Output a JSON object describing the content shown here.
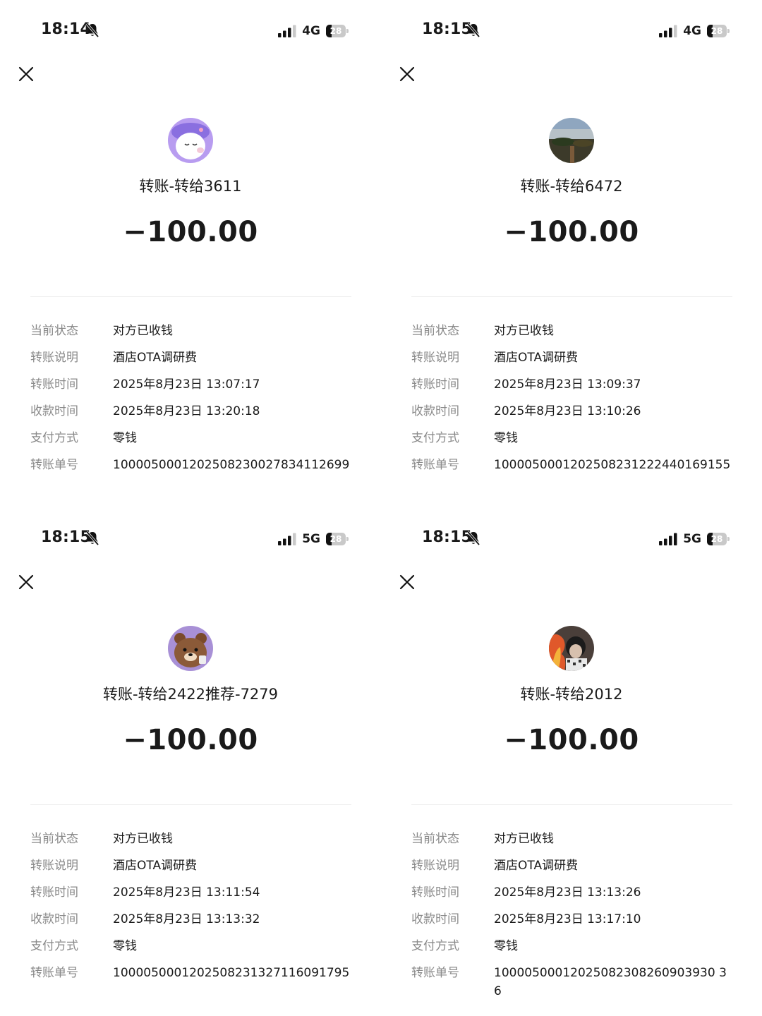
{
  "labels": {
    "status": "当前状态",
    "remark": "转账说明",
    "transfer_time": "转账时间",
    "receive_time": "收款时间",
    "pay_method": "支付方式",
    "order_no": "转账单号"
  },
  "icons": {
    "close": "close-icon",
    "mute": "bell-slash-icon",
    "signal": "cellular-signal-icon",
    "battery": "battery-icon"
  },
  "colors": {
    "label_text": "#8a8a8a",
    "value_text": "#1a1a1a",
    "divider": "#ededed"
  },
  "panels": [
    {
      "time": "18:14",
      "network": "4G",
      "battery": "28",
      "battery_fraction": 0.28,
      "signal_bars": 3,
      "avatar": "avatar-purple-hat-cartoon",
      "title": "转账-转给3611",
      "amount": "−100.00",
      "status": "对方已收钱",
      "remark": "酒店OTA调研费",
      "transfer_time": "2025年8月23日 13:07:17",
      "receive_time": "2025年8月23日 13:20:18",
      "pay_method": "零钱",
      "order_no": "1000050001202508230027834112699"
    },
    {
      "time": "18:15",
      "network": "4G",
      "battery": "28",
      "battery_fraction": 0.28,
      "signal_bars": 3,
      "avatar": "avatar-landscape-photo",
      "title": "转账-转给6472",
      "amount": "−100.00",
      "status": "对方已收钱",
      "remark": "酒店OTA调研费",
      "transfer_time": "2025年8月23日 13:09:37",
      "receive_time": "2025年8月23日 13:10:26",
      "pay_method": "零钱",
      "order_no": "1000050001202508231222440169155"
    },
    {
      "time": "18:15",
      "network": "5G",
      "battery": "28",
      "battery_fraction": 0.28,
      "signal_bars": 3,
      "avatar": "avatar-brown-bear",
      "title": "转账-转给2422推荐-7279",
      "amount": "−100.00",
      "status": "对方已收钱",
      "remark": "酒店OTA调研费",
      "transfer_time": "2025年8月23日 13:11:54",
      "receive_time": "2025年8月23日 13:13:32",
      "pay_method": "零钱",
      "order_no": "1000050001202508231327116091795"
    },
    {
      "time": "18:15",
      "network": "5G",
      "battery": "28",
      "battery_fraction": 0.28,
      "signal_bars": 4,
      "avatar": "avatar-person-with-fire",
      "title": "转账-转给2012",
      "amount": "−100.00",
      "status": "对方已收钱",
      "remark": "酒店OTA调研费",
      "transfer_time": "2025年8月23日 13:13:26",
      "receive_time": "2025年8月23日 13:17:10",
      "pay_method": "零钱",
      "order_no": "10000500012025082308260903930 36"
    }
  ]
}
